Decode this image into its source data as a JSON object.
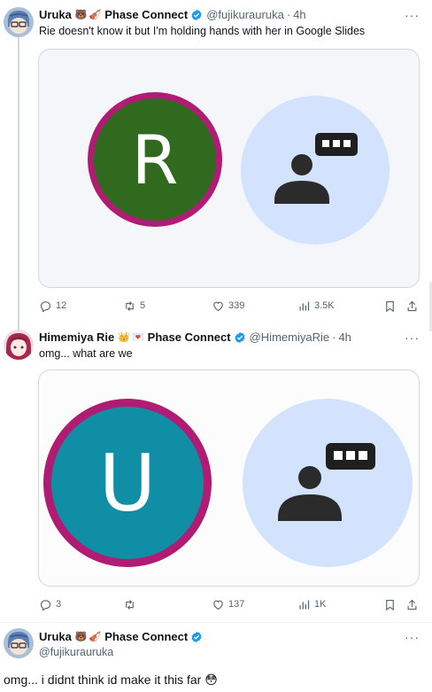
{
  "tweets": [
    {
      "name": "Uruka",
      "emojis": [
        "🐻",
        "🎻"
      ],
      "org": "Phase Connect",
      "handle": "@fujikurauruka",
      "time": "4h",
      "text": "Rie doesn't know it but I'm holding hands with her in Google Slides",
      "media": {
        "letter": "R",
        "letter_circle_color": "#306a1f",
        "ring_color": "#b01b73",
        "icon_bg_color": "#d3e3fd"
      },
      "stats": {
        "replies": "12",
        "reposts": "5",
        "likes": "339",
        "views": "3.5K"
      }
    },
    {
      "name": "Himemiya Rie",
      "emojis": [
        "👑",
        "💌"
      ],
      "org": "Phase Connect",
      "handle": "@HimemiyaRie",
      "time": "4h",
      "text": "omg... what are we",
      "media": {
        "letter": "U",
        "letter_circle_color": "#0f8ea5",
        "ring_color": "#b01b73",
        "icon_bg_color": "#d3e3fd"
      },
      "stats": {
        "replies": "3",
        "reposts": "",
        "likes": "137",
        "views": "1K"
      }
    },
    {
      "name": "Uruka",
      "emojis": [
        "🐻",
        "🎻"
      ],
      "org": "Phase Connect",
      "handle": "@fujikurauruka",
      "text": "omg...  i didnt think id make it this far 😳"
    }
  ],
  "more_label": "···",
  "accent_color": "#1d9bf0",
  "icons": [
    "reply-icon",
    "repost-icon",
    "like-icon",
    "views-icon",
    "bookmark-icon",
    "share-icon",
    "verified-icon",
    "person-chat-icon",
    "more-icon"
  ]
}
